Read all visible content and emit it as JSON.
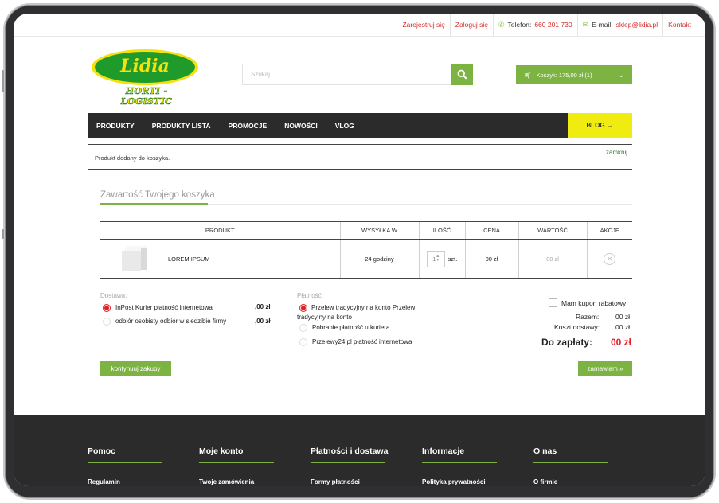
{
  "topbar": {
    "register": "Zarejestruj się",
    "login": "Zaloguj się",
    "phone_label": "Telefon:",
    "phone_value": "660 201 730",
    "email_label": "E-mail:",
    "email_value": "sklep@lidia.pl",
    "contact": "Kontakt"
  },
  "logo": {
    "name": "Lidia",
    "sub": "HORTI - LOGISTIC"
  },
  "search": {
    "placeholder": "Szukaj"
  },
  "cart_button": {
    "label": "Koszyk: 175,00 zł (1)"
  },
  "nav": {
    "items": [
      "PRODUKTY",
      "PRODUKTY LISTA",
      "PROMOCJE",
      "NOWOŚCI",
      "VLOG"
    ],
    "blog": "BLOG"
  },
  "notice": {
    "message": "Produkt dodany do koszyka.",
    "close": "zamknij"
  },
  "page_title": "Zawartość Twojego koszyka",
  "table": {
    "headers": [
      "PRODUKT",
      "WYSYŁKA W",
      "ILOŚĆ",
      "CENA",
      "WARTOŚĆ",
      "AKCJE"
    ],
    "rows": [
      {
        "name": "LOREM IPSUM",
        "shipping": "24 godziny",
        "qty": "1",
        "unit": "szt.",
        "price": "00 zł",
        "value": "00 zł"
      }
    ]
  },
  "delivery": {
    "label": "Dostawa:",
    "options": [
      {
        "name": "InPost Kurier płatność internetowa",
        "price": ",00 zł",
        "selected": true
      },
      {
        "name": "odbiór osobisty odbiór w siedzibie firmy",
        "price": ",00 zł",
        "selected": false
      }
    ]
  },
  "payment": {
    "label": "Płatność:",
    "options": [
      {
        "name": "Przelew tradycyjny na konto Przelew tradycyjny na konto",
        "selected": true
      },
      {
        "name": "Pobranie płatność u kuriera",
        "selected": false
      },
      {
        "name": "Przelewy24.pl płatność internetowa",
        "selected": false
      }
    ]
  },
  "summary": {
    "coupon": "Mam kupon rabatowy",
    "total_label": "Razem:",
    "total_value": "00 zł",
    "shipping_label": "Koszt dostawy:",
    "shipping_value": "00 zł",
    "topay_label": "Do zapłaty:",
    "topay_value": "00 zł"
  },
  "buttons": {
    "continue": "kontynuuj zakupy",
    "order": "zamawiam »"
  },
  "footer": {
    "columns": [
      {
        "title": "Pomoc",
        "first": "Regulamin"
      },
      {
        "title": "Moje konto",
        "first": "Twoje zamówienia"
      },
      {
        "title": "Płatności i dostawa",
        "first": "Formy płatności"
      },
      {
        "title": "Informacje",
        "first": "Polityka prywatności"
      },
      {
        "title": "O nas",
        "first": "O firmie"
      }
    ]
  },
  "colors": {
    "accent": "#7cb342",
    "red": "#e31e24",
    "dark": "#2b2b2b",
    "blog": "#f0eb10"
  }
}
